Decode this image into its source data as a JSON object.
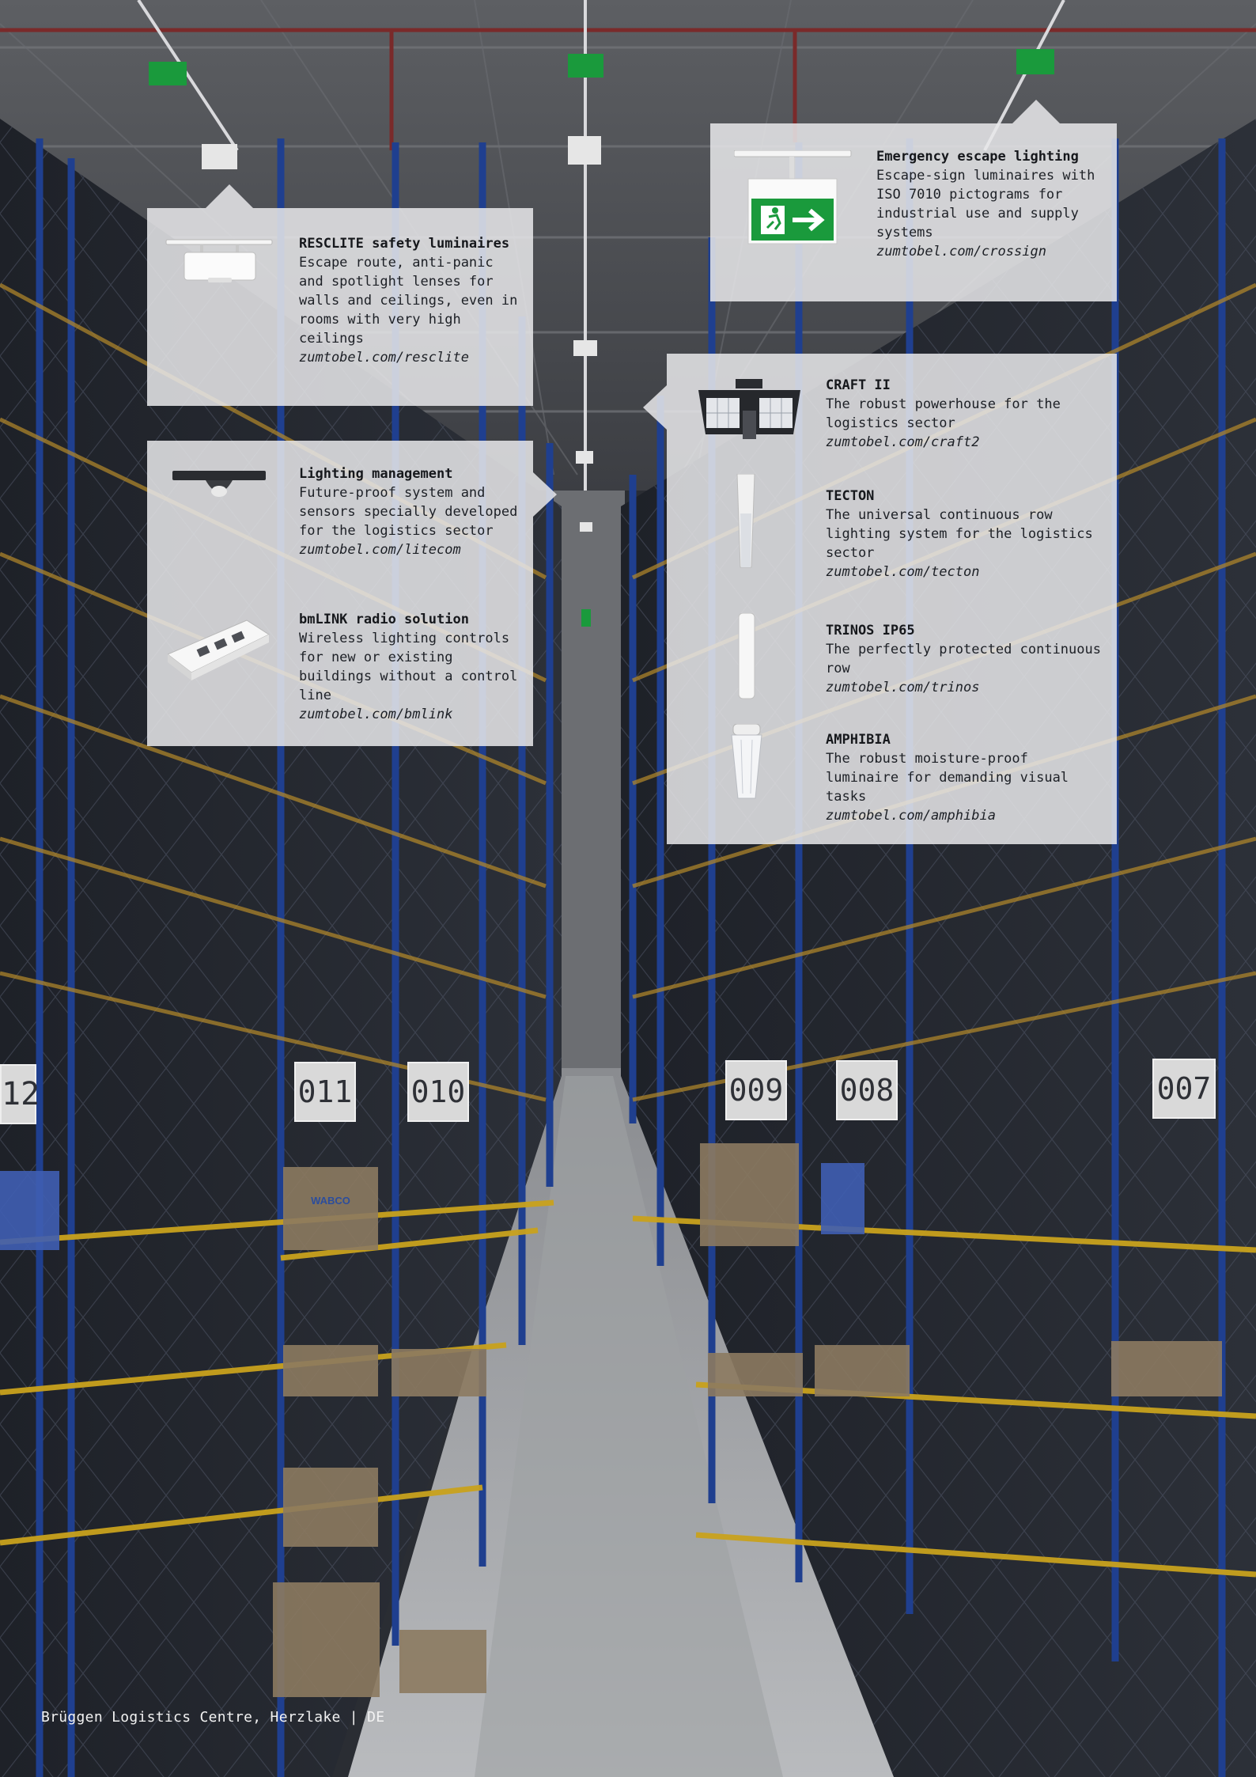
{
  "panels": {
    "resclite": {
      "title": "RESCLITE safety luminaires",
      "desc": "Escape route, anti-panic and spotlight lenses for walls and ceilings, even in rooms with very high ceilings",
      "url": "zumtobel.com/resclite",
      "icon": "resclite-luminaire-icon"
    },
    "escape": {
      "title": "Emergency escape lighting",
      "desc": "Escape-sign luminaires with ISO 7010 pictograms for industrial use and supply systems",
      "url": "zumtobel.com/crossign",
      "icon": "escape-sign-icon"
    },
    "management": {
      "items": [
        {
          "title": "Lighting management",
          "desc": "Future-proof system and sensors specially developed for the logistics sector",
          "url": "zumtobel.com/litecom",
          "icon": "sensor-icon"
        },
        {
          "title": "bmLINK radio solution",
          "desc": "Wireless lighting controls for new or existing buildings without a control line",
          "url": "zumtobel.com/bmlink",
          "icon": "radio-module-icon"
        }
      ]
    },
    "products": {
      "items": [
        {
          "title": "CRAFT II",
          "desc": "The robust powerhouse for the logistics sector",
          "url": "zumtobel.com/craft2",
          "icon": "high-bay-luminaire-icon"
        },
        {
          "title": "TECTON",
          "desc": "The universal continuous row lighting system for the logistics sector",
          "url": "zumtobel.com/tecton",
          "icon": "continuous-row-icon"
        },
        {
          "title": "TRINOS IP65",
          "desc": "The perfectly protected continuous row",
          "url": "zumtobel.com/trinos",
          "icon": "linear-luminaire-icon"
        },
        {
          "title": "AMPHIBIA",
          "desc": "The robust moisture-proof luminaire for demanding visual tasks",
          "url": "zumtobel.com/amphibia",
          "icon": "moisture-proof-luminaire-icon"
        }
      ]
    }
  },
  "aisle_labels": [
    "12",
    "011",
    "010",
    "009",
    "008",
    "007"
  ],
  "crate_label": "WABCO",
  "caption": "Brüggen Logistics Centre, Herzlake | DE",
  "colors": {
    "panel_bg": "#e8e8ea",
    "rack_blue": "#1f3f8f",
    "beam_yellow": "#c9a21d",
    "sign_green": "#1a9a3c"
  }
}
